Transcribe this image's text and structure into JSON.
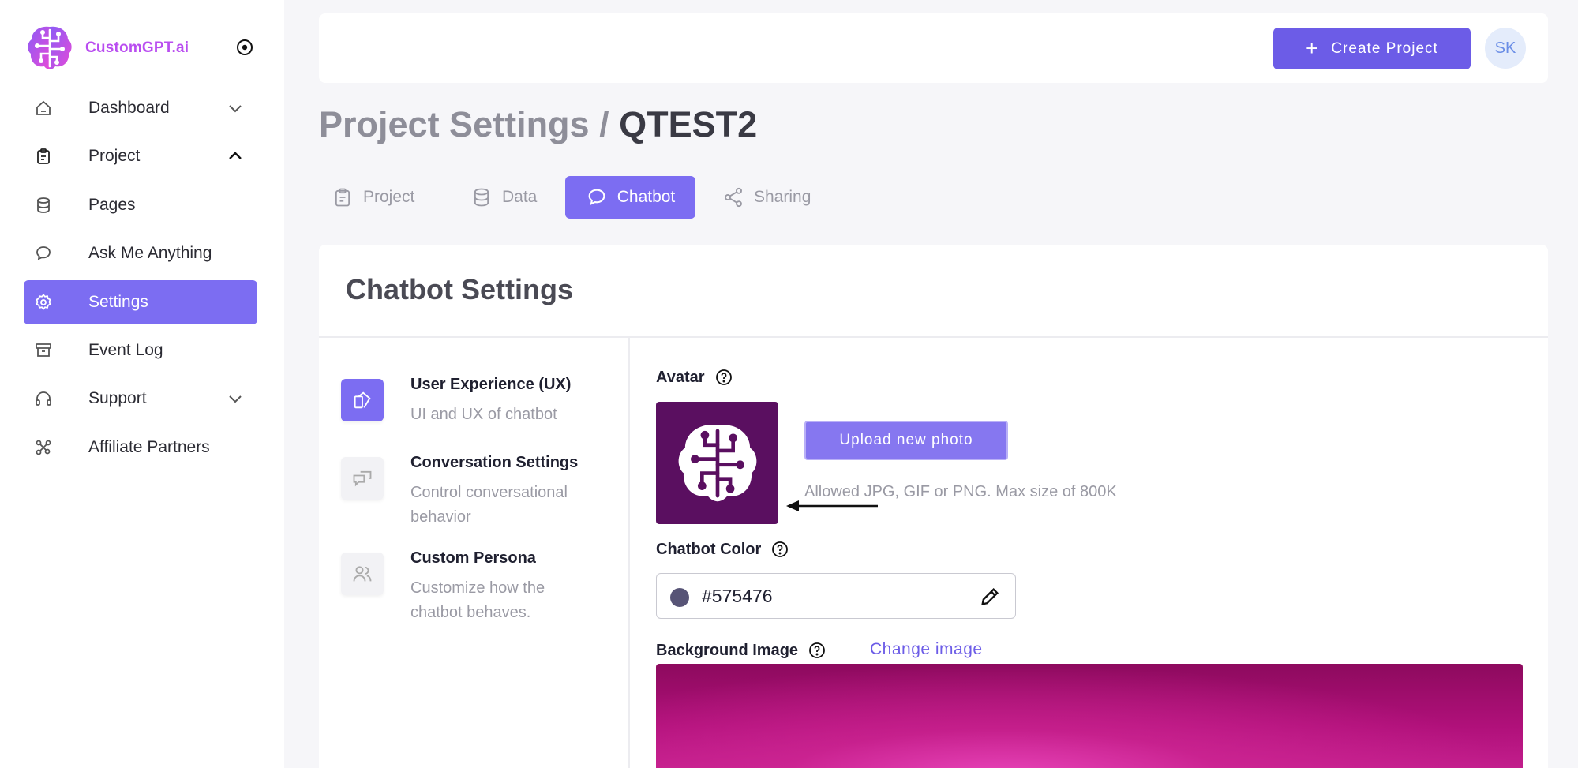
{
  "brand": {
    "name": "CustomGPT.ai"
  },
  "sidebar": {
    "items": [
      {
        "label": "Dashboard",
        "icon": "home-icon",
        "chevron": "down"
      },
      {
        "label": "Project",
        "icon": "clipboard-icon",
        "chevron": "up"
      },
      {
        "label": "Pages",
        "icon": "database-icon"
      },
      {
        "label": "Ask Me Anything",
        "icon": "chat-icon"
      },
      {
        "label": "Settings",
        "icon": "gear-icon",
        "active": true
      },
      {
        "label": "Event Log",
        "icon": "archive-icon"
      },
      {
        "label": "Support",
        "icon": "headset-icon",
        "chevron": "down"
      },
      {
        "label": "Affiliate Partners",
        "icon": "affiliate-icon"
      }
    ]
  },
  "header": {
    "create_label": "Create Project",
    "user_initials": "SK"
  },
  "page": {
    "crumb": "Project Settings /",
    "current": "QTEST2"
  },
  "tabs": [
    {
      "label": "Project",
      "icon": "clipboard-icon"
    },
    {
      "label": "Data",
      "icon": "database-icon"
    },
    {
      "label": "Chatbot",
      "icon": "chat-icon",
      "active": true
    },
    {
      "label": "Sharing",
      "icon": "share-icon"
    }
  ],
  "card": {
    "title": "Chatbot Settings",
    "sections": [
      {
        "title": "User Experience (UX)",
        "desc": "UI and UX of chatbot",
        "icon": "ux-icon",
        "active": true
      },
      {
        "title": "Conversation Settings",
        "desc": "Control conversational behavior",
        "icon": "conversation-icon"
      },
      {
        "title": "Custom Persona",
        "desc": "Customize how the chatbot behaves.",
        "icon": "users-icon"
      }
    ],
    "avatar": {
      "label": "Avatar",
      "upload_label": "Upload new photo",
      "hint": "Allowed JPG, GIF or PNG. Max size of 800K"
    },
    "chatbot_color": {
      "label": "Chatbot Color",
      "value": "#575476"
    },
    "background_image": {
      "label": "Background Image",
      "change_label": "Change image"
    }
  },
  "colors": {
    "accent": "#7c6df2",
    "button": "#6c5ce7",
    "avatar_bg": "#5a0f60",
    "swatch": "#575476"
  }
}
